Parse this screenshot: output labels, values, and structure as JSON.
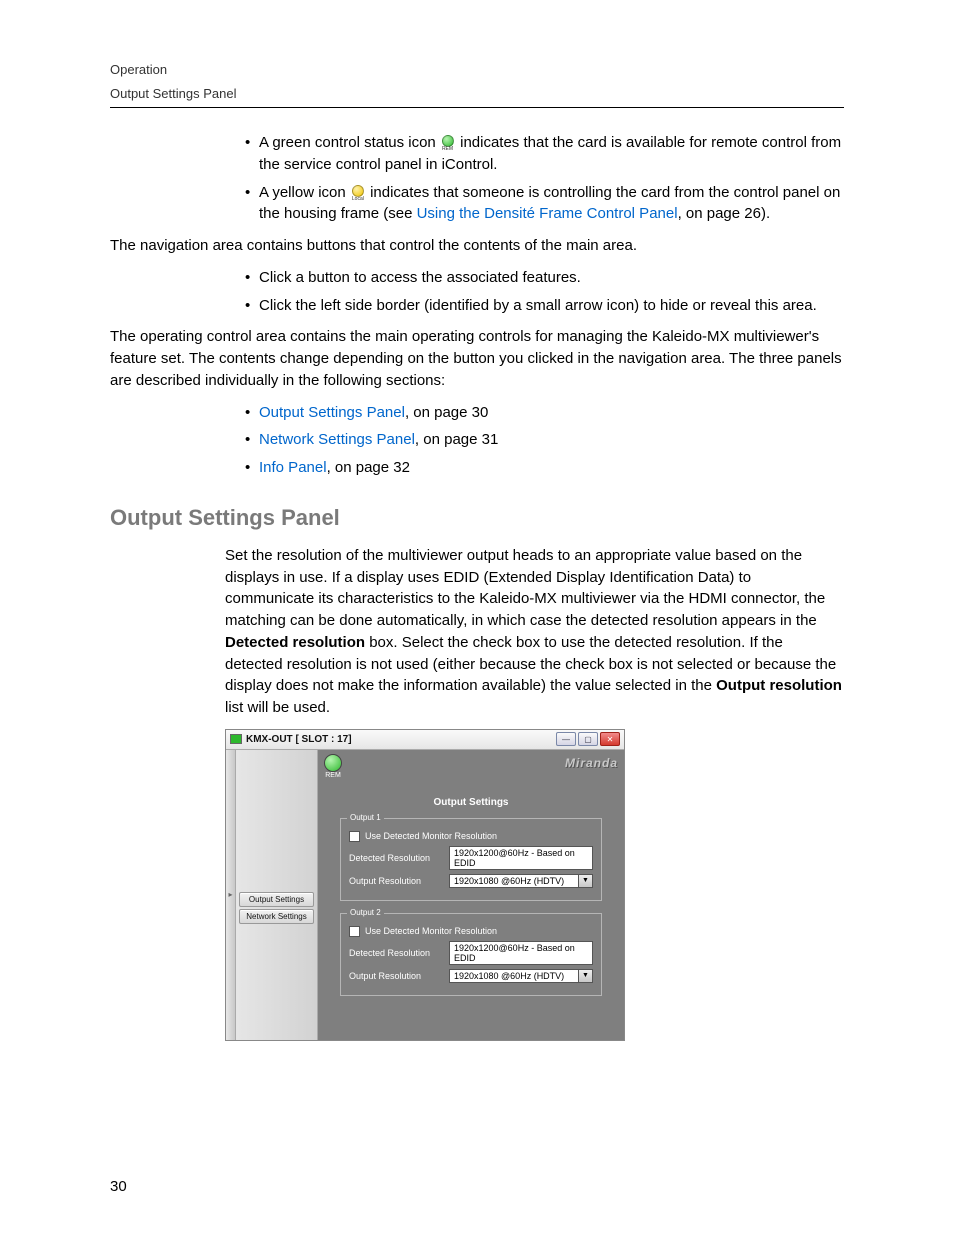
{
  "header": {
    "line1": "Operation",
    "line2": "Output Settings Panel"
  },
  "icons": {
    "rem": "REM",
    "local": "Local"
  },
  "bullets1": [
    {
      "pre": "A green control status icon ",
      "post": " indicates that the card is available for remote control from the service control panel in iControl."
    },
    {
      "pre": "A yellow icon ",
      "mid": " indicates that someone is controlling the card from the control panel on the housing frame (see ",
      "link": "Using the Densité Frame Control Panel",
      "post": ", on page 26)."
    }
  ],
  "para": {
    "nav": "The navigation area contains buttons that control the contents of the main area.",
    "operating": "The operating control area contains the main operating controls for managing the Kaleido-MX multiviewer's feature set. The contents change depending on the button you clicked in the navigation area. The three panels are described individually in the following sections:"
  },
  "bullets2": [
    "Click a button to access the associated features.",
    "Click the left side border (identified by a small arrow icon) to hide or reveal this area."
  ],
  "bullets3": [
    {
      "link": "Output Settings Panel",
      "post": ", on page 30"
    },
    {
      "link": "Network Settings Panel",
      "post": ", on page 31"
    },
    {
      "link": "Info Panel",
      "post": ", on page 32"
    }
  ],
  "section": {
    "heading": "Output Settings Panel",
    "body": {
      "a": "Set the resolution of the multiviewer output heads to an appropriate value based on the displays in use. If a display uses EDID (Extended Display Identification Data) to communicate its characteristics to the Kaleido-MX multiviewer via the HDMI connector, the matching can be done automatically, in which case the detected resolution appears in the ",
      "b1": "Detected resolution",
      "c": " box. Select the check box to use the detected resolution. If the detected resolution is not used (either because the check box is not selected or because the display does not make the information available) the value selected in the ",
      "b2": "Output resolution",
      "d": " list will be used."
    }
  },
  "shot": {
    "title": "KMX-OUT [ SLOT : 17]",
    "rem": "REM",
    "brand": "Miranda",
    "panelTitle": "Output Settings",
    "nav": [
      "Output Settings",
      "Network Settings"
    ],
    "labels": {
      "useDetected": "Use Detected Monitor Resolution",
      "detected": "Detected Resolution",
      "output": "Output Resolution"
    },
    "out1": {
      "legend": "Output 1",
      "detected": "1920x1200@60Hz - Based on EDID",
      "output": "1920x1080 @60Hz (HDTV)"
    },
    "out2": {
      "legend": "Output 2",
      "detected": "1920x1200@60Hz - Based on EDID",
      "output": "1920x1080 @60Hz (HDTV)"
    }
  },
  "pageNumber": "30"
}
